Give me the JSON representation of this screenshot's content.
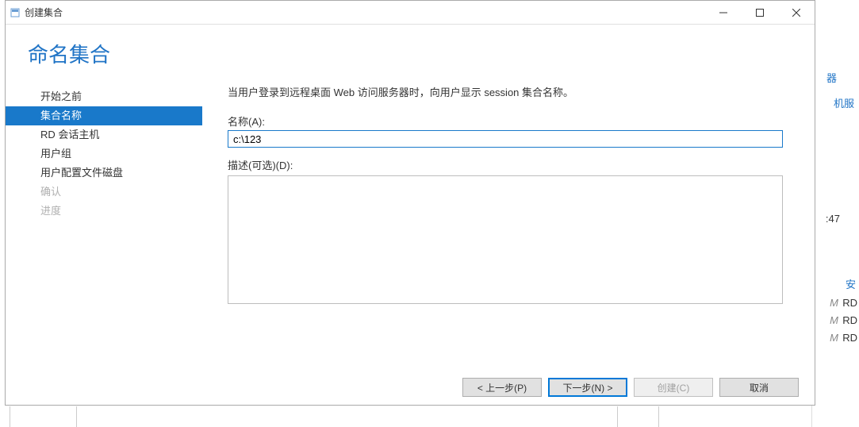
{
  "window": {
    "title": "创建集合"
  },
  "page": {
    "title": "命名集合",
    "instruction": "当用户登录到远程桌面 Web 访问服务器时，向用户显示 session 集合名称。"
  },
  "sidebar": {
    "items": [
      {
        "label": "开始之前",
        "active": false,
        "disabled": false
      },
      {
        "label": "集合名称",
        "active": true,
        "disabled": false
      },
      {
        "label": "RD 会话主机",
        "active": false,
        "disabled": false
      },
      {
        "label": "用户组",
        "active": false,
        "disabled": false
      },
      {
        "label": "用户配置文件磁盘",
        "active": false,
        "disabled": false
      },
      {
        "label": "确认",
        "active": false,
        "disabled": true
      },
      {
        "label": "进度",
        "active": false,
        "disabled": true
      }
    ]
  },
  "form": {
    "name_label": "名称(A):",
    "name_value": "c:\\123",
    "desc_label": "描述(可选)(D):",
    "desc_value": ""
  },
  "buttons": {
    "prev": "< 上一步(P)",
    "next": "下一步(N) >",
    "create": "创建(C)",
    "cancel": "取消"
  },
  "background": {
    "link1": "器",
    "link2": "机服",
    "time": ":47",
    "col_header": "安",
    "rows": [
      "RD",
      "RD",
      "RD"
    ],
    "row_prefix": "M"
  }
}
